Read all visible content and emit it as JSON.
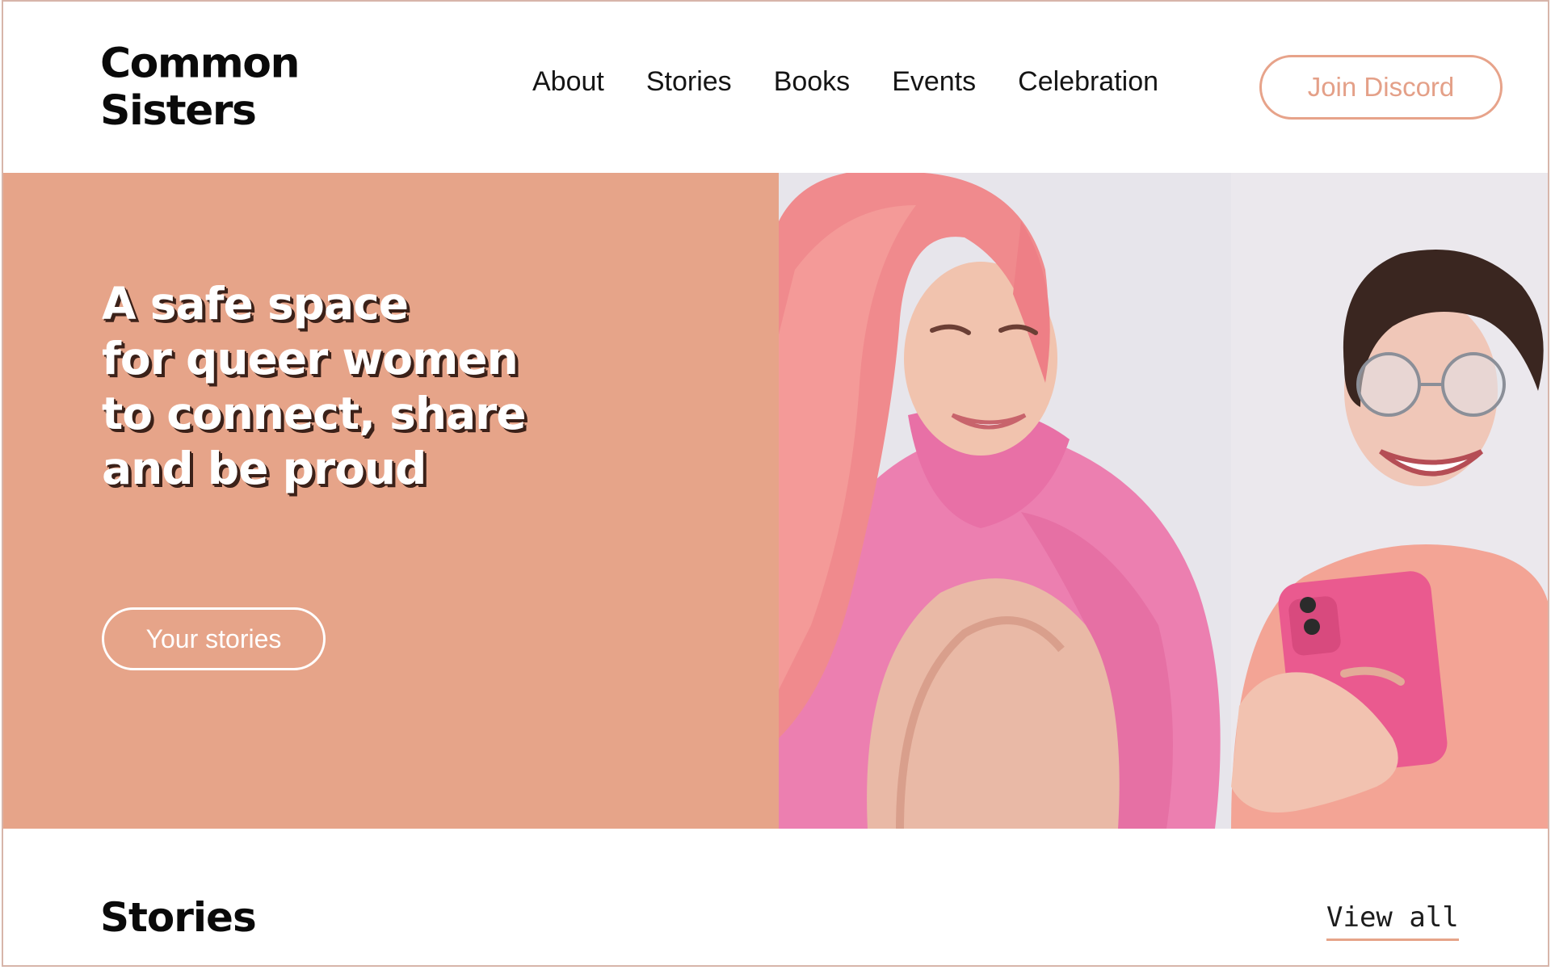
{
  "site": {
    "logo_line1": "Common",
    "logo_line2": "Sisters"
  },
  "nav": {
    "items": [
      {
        "label": "About"
      },
      {
        "label": "Stories"
      },
      {
        "label": "Books"
      },
      {
        "label": "Events"
      },
      {
        "label": "Celebration"
      }
    ],
    "join_label": "Join Discord"
  },
  "hero": {
    "title_lines": [
      "A safe space",
      "for queer women",
      "to connect, share",
      "and be proud"
    ],
    "cta_label": "Your stories",
    "photo": "two-laughing-friends-photo"
  },
  "stories": {
    "heading": "Stories",
    "view_all_label": "View all"
  },
  "colors": {
    "accent": "#e6a489",
    "button_border": "#e7a38a",
    "text_dark": "#0a0a0a",
    "frame_border": "#d7b5aa"
  }
}
